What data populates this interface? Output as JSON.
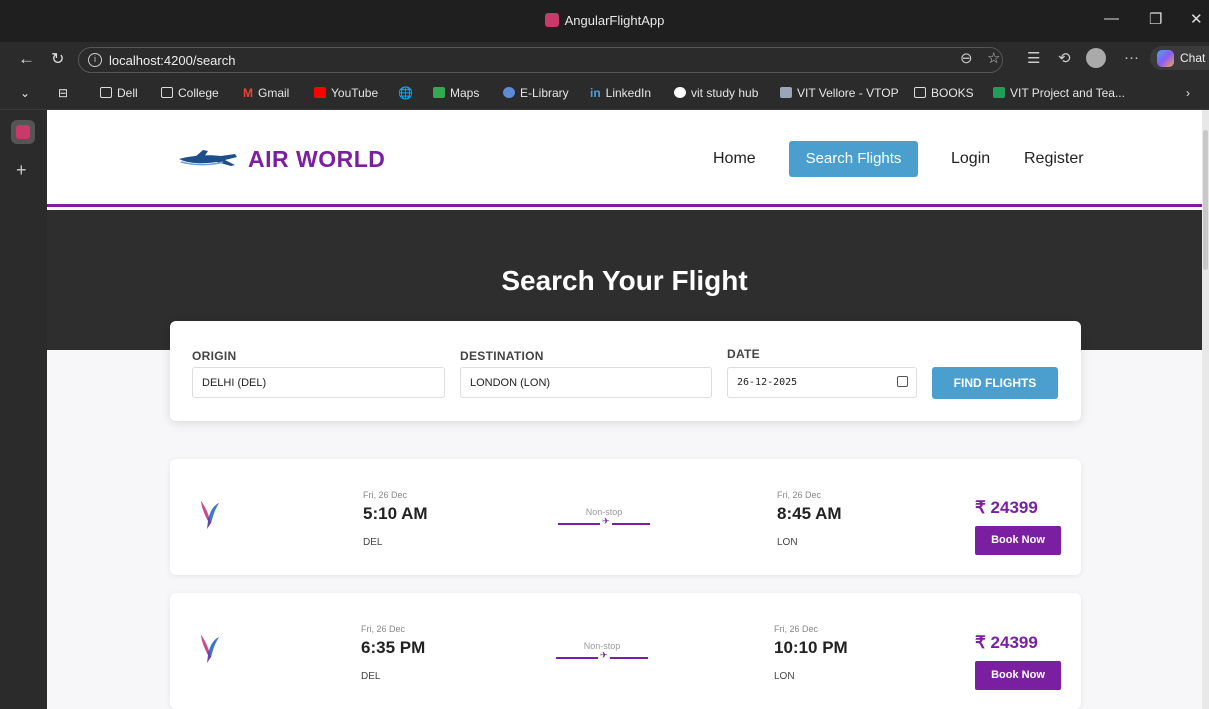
{
  "window": {
    "title": "AngularFlightApp"
  },
  "browser": {
    "url": "localhost:4200/search",
    "chat_label": "Chat",
    "bookmarks": [
      {
        "label": "Dell",
        "icon": "folder-icon"
      },
      {
        "label": "College",
        "icon": "folder-icon"
      },
      {
        "label": "Gmail",
        "icon": "gmail-icon"
      },
      {
        "label": "YouTube",
        "icon": "youtube-icon"
      },
      {
        "label": "",
        "icon": "globe-icon"
      },
      {
        "label": "Maps",
        "icon": "maps-icon"
      },
      {
        "label": "E-Library",
        "icon": "library-icon"
      },
      {
        "label": "LinkedIn",
        "icon": "linkedin-icon"
      },
      {
        "label": "vit study hub",
        "icon": "study-hub-icon"
      },
      {
        "label": "VIT Vellore - VTOP",
        "icon": "vtop-icon"
      },
      {
        "label": "BOOKS",
        "icon": "folder-icon"
      },
      {
        "label": "VIT Project and Tea...",
        "icon": "project-icon"
      }
    ]
  },
  "site": {
    "brand": "AIR WORLD",
    "nav": {
      "home": "Home",
      "search": "Search Flights",
      "login": "Login",
      "register": "Register"
    },
    "hero_title": "Search Your Flight"
  },
  "search": {
    "origin_label": "ORIGIN",
    "origin_value": "DELHI (DEL)",
    "destination_label": "DESTINATION",
    "destination_value": "LONDON (LON)",
    "date_label": "DATE",
    "date_value": "26-12-2025",
    "button": "FIND FLIGHTS"
  },
  "flights": [
    {
      "dep_date": "Fri, 26 Dec",
      "dep_time": "5:10 AM",
      "dep_code": "DEL",
      "stops": "Non-stop",
      "arr_date": "Fri, 26 Dec",
      "arr_time": "8:45 AM",
      "arr_code": "LON",
      "price": "₹ 24399",
      "book": "Book Now"
    },
    {
      "dep_date": "Fri, 26 Dec",
      "dep_time": "6:35 PM",
      "dep_code": "DEL",
      "stops": "Non-stop",
      "arr_date": "Fri, 26 Dec",
      "arr_time": "10:10 PM",
      "arr_code": "LON",
      "price": "₹ 24399",
      "book": "Book Now"
    }
  ],
  "colors": {
    "brand": "#7b1fa2",
    "accent": "#4a9fcf",
    "hero": "#2e2e2e"
  }
}
